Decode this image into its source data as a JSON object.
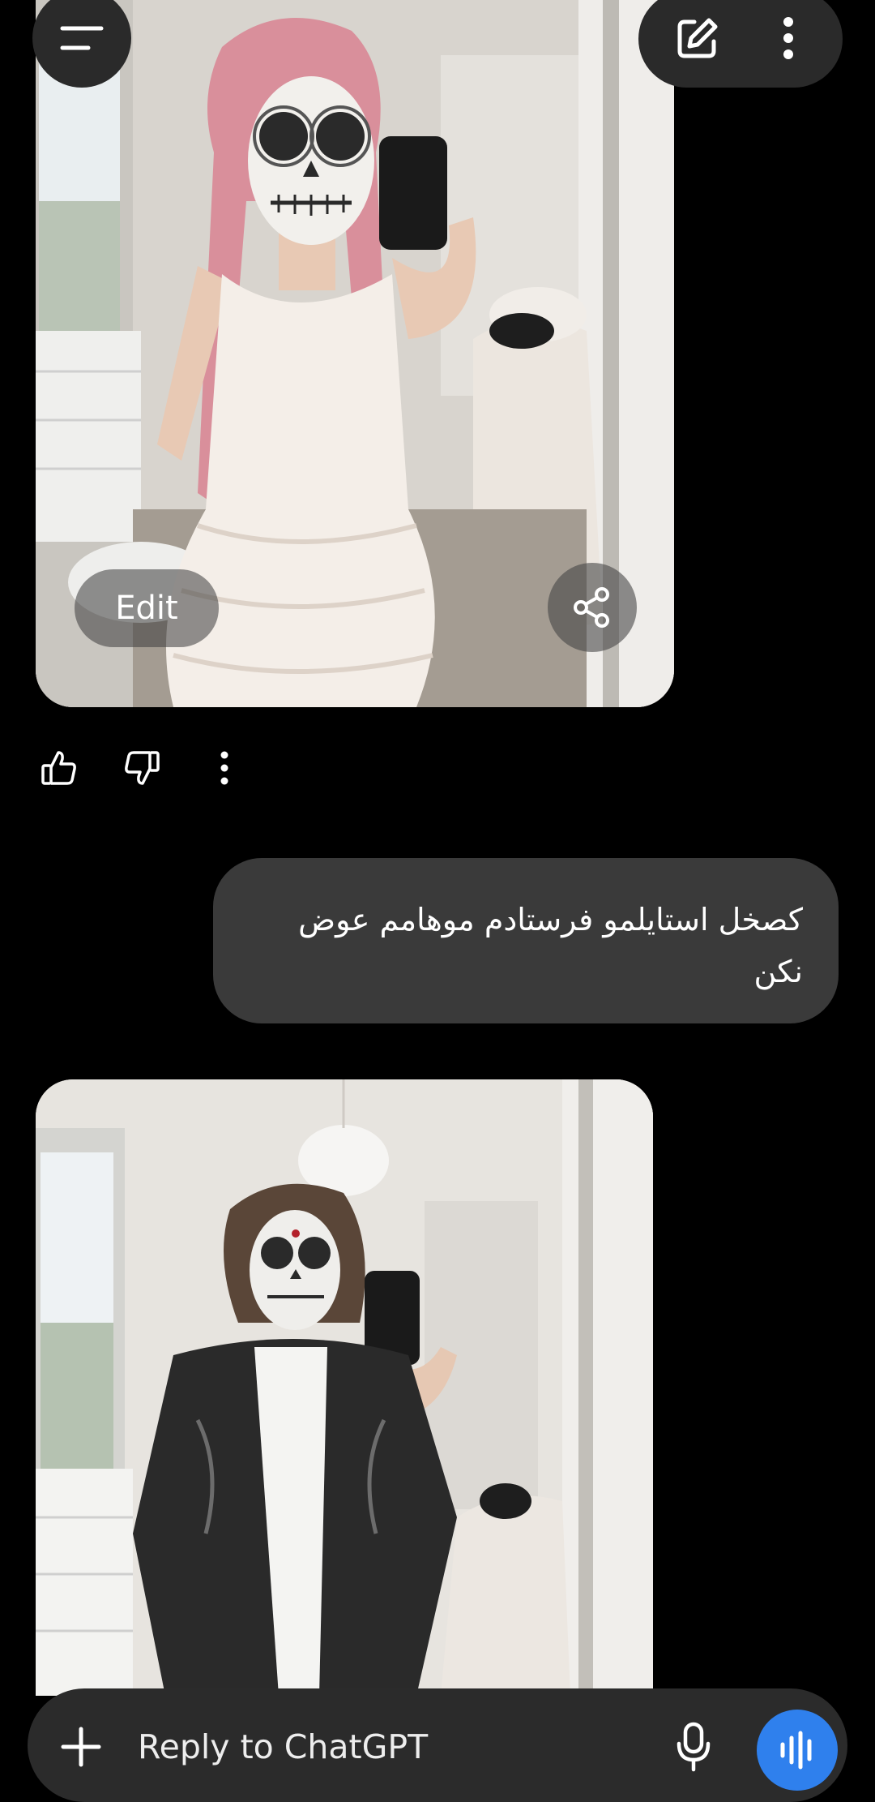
{
  "assistant_image": {
    "edit_label": "Edit"
  },
  "user_message": {
    "text": "کصخل استایلمو فرستادم موهامم عوض نکن"
  },
  "composer": {
    "placeholder": "Reply to ChatGPT"
  },
  "colors": {
    "background": "#000000",
    "bubble": "#3a3a3a",
    "composer": "#2b2b2b",
    "voice_button": "#2f80ed"
  },
  "icons": {
    "menu": "hamburger-icon",
    "new_chat": "edit-icon",
    "more": "more-vertical-icon",
    "share": "share-icon",
    "like": "thumbs-up-icon",
    "dislike": "thumbs-down-icon",
    "add": "plus-icon",
    "mic": "mic-icon",
    "voice": "voice-wave-icon"
  }
}
